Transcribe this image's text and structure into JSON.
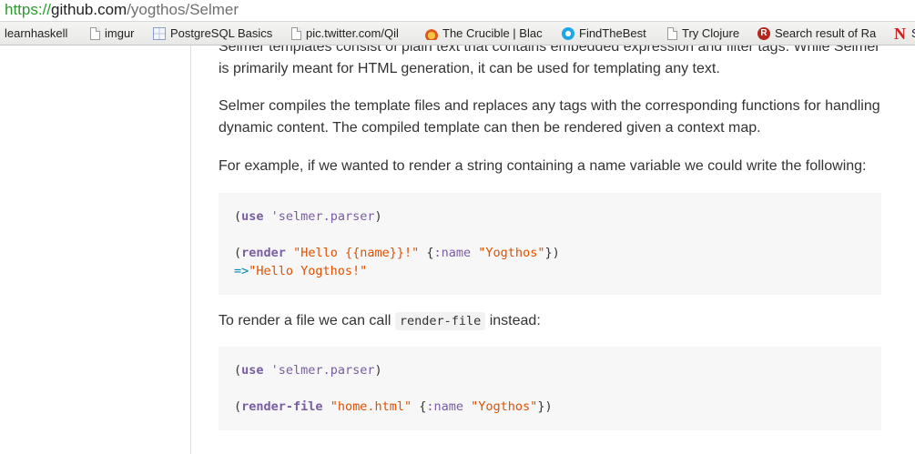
{
  "url": {
    "scheme": "https://",
    "host": "github.com",
    "path": "/yogthos/Selmer"
  },
  "bookmarks": [
    {
      "label": "learnhaskell",
      "icon": "none"
    },
    {
      "label": "imgur",
      "icon": "page-icon"
    },
    {
      "label": "PostgreSQL Basics",
      "icon": "grid-icon"
    },
    {
      "label": "pic.twitter.com/Qil",
      "icon": "page-icon"
    },
    {
      "label": "The Crucible | Blac",
      "icon": "flame-icon"
    },
    {
      "label": "FindTheBest",
      "icon": "ring-icon"
    },
    {
      "label": "Try Clojure",
      "icon": "page-icon"
    },
    {
      "label": "Search result of Ra",
      "icon": "r-icon"
    },
    {
      "label": "S",
      "icon": "n-icon"
    }
  ],
  "article": {
    "p0_line1": "Selmer templates consist of plain text that contains embedded expression and filter tags. While Selmer",
    "p0_line2": "is primarily meant for HTML generation, it can be used for templating any text.",
    "p1_line1": "Selmer compiles the template files and replaces any tags with the corresponding functions for handling",
    "p1_line2": "dynamic content. The compiled template can then be rendered given a context map.",
    "p2": "For example, if we wanted to render a string containing a name variable we could write the following:",
    "p3_before": "To render a file we can call ",
    "p3_code": "render-file",
    "p3_after": " instead:"
  },
  "code1": {
    "use_kw": "use",
    "ns": "'selmer.parser",
    "render_fn": "render",
    "template_str": "\"Hello {{name}}!\"",
    "key": ":name",
    "value": "\"Yogthos\"",
    "arrow": "=>",
    "result": "\"Hello Yogthos!\""
  },
  "code2": {
    "use_kw": "use",
    "ns": "'selmer.parser",
    "render_fn": "render-file",
    "file_str": "\"home.html\"",
    "key": ":name",
    "value": "\"Yogthos\""
  },
  "colors": {
    "url_scheme": "#2c9b2c",
    "code_keyword": "#795da3",
    "code_string": "#df5000",
    "code_arrow": "#0086b3",
    "code_bg": "#f7f7f7"
  }
}
